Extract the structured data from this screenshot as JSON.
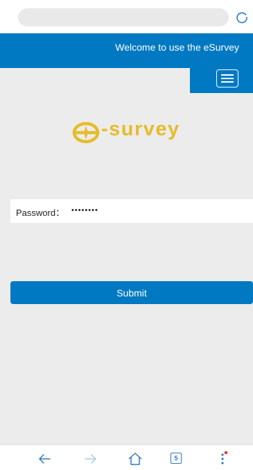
{
  "browser": {
    "tab_count": "5"
  },
  "header": {
    "title": "Welcome to use the eSurvey"
  },
  "logo": {
    "text": "-survey"
  },
  "form": {
    "password_label": "Password：",
    "password_value": "••••••••",
    "submit_label": "Submit"
  },
  "colors": {
    "primary": "#0079c2",
    "logo": "#e6bc2c",
    "background": "#ececec",
    "notification_dot": "#e53935"
  },
  "icons": {
    "reload": "reload-icon",
    "menu": "hamburger-menu-icon",
    "logo_mark": "e-survey-logo-mark",
    "back": "arrow-left-icon",
    "forward": "arrow-right-icon",
    "home": "home-icon",
    "tabs": "tabs-icon",
    "more": "more-vertical-icon"
  }
}
